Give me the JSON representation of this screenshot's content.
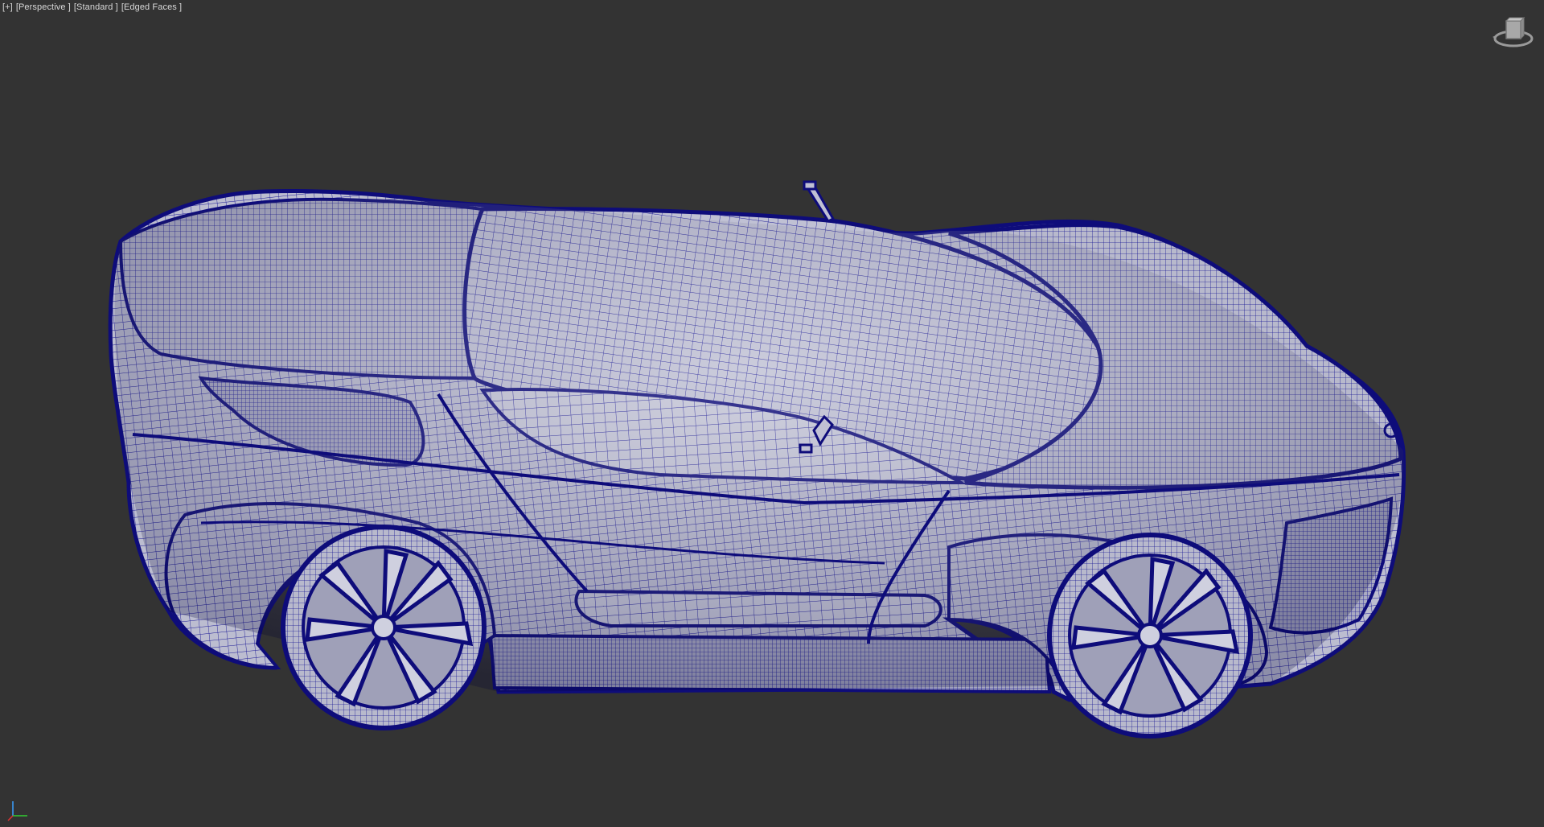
{
  "viewport": {
    "labels": {
      "menu": "[+]",
      "view": "[Perspective ]",
      "shading": "[Standard ]",
      "display": "[Edged Faces ]"
    },
    "background_color": "#333333",
    "wire_color": "#14148c",
    "surface_color": "#b4b4c8"
  },
  "scene": {
    "object": "sports-car-wireframe-mesh",
    "view_widget": "viewcube-icon",
    "axis_widget": "axis-tripod-icon"
  }
}
